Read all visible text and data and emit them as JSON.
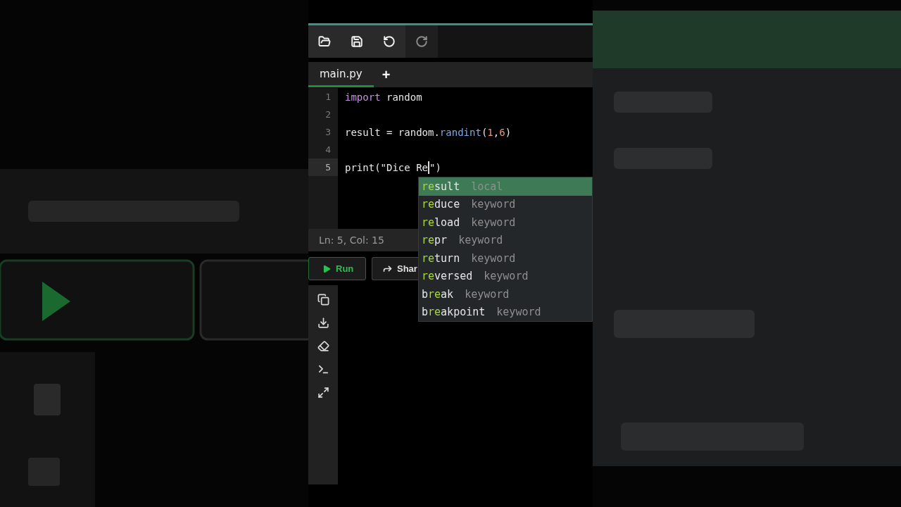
{
  "toolbar": [
    {
      "kind": "open",
      "disabled": false
    },
    {
      "kind": "save",
      "disabled": false
    },
    {
      "kind": "undo",
      "disabled": false
    },
    {
      "kind": "redo",
      "disabled": true
    }
  ],
  "tabs": [
    {
      "label": "main.py",
      "selected": true
    }
  ],
  "add_tab": "+",
  "editor": {
    "lines": [
      {
        "number": "1",
        "active": false,
        "tokens": [
          {
            "kind": "keyword",
            "text": "import"
          },
          {
            "kind": "plain",
            "text": " random"
          }
        ]
      },
      {
        "number": "2",
        "active": false
      },
      {
        "number": "3",
        "active": false,
        "tokens": [
          {
            "kind": "plain",
            "text": "result = random."
          },
          {
            "kind": "function",
            "text": "randint"
          },
          {
            "kind": "plain",
            "text": "("
          },
          {
            "kind": "number",
            "text": "1"
          },
          {
            "kind": "plain",
            "text": ","
          },
          {
            "kind": "number",
            "text": "6"
          },
          {
            "kind": "plain",
            "text": ")"
          }
        ]
      },
      {
        "number": "4",
        "active": false
      },
      {
        "number": "5",
        "active": true,
        "tokens": [
          {
            "kind": "plain",
            "text": "print(\"Dice Re"
          },
          {
            "kind": "cursor"
          },
          {
            "kind": "plain",
            "text": "\")"
          }
        ]
      }
    ]
  },
  "status_bar": "Ln: 5, Col: 15",
  "run_button": "Run",
  "share_button": "Shar",
  "autocomplete": [
    {
      "match": "re",
      "after": "sult",
      "detail": "local",
      "selected": true
    },
    {
      "match": "re",
      "after": "duce",
      "detail": "keyword",
      "selected": false
    },
    {
      "match": "re",
      "after": "load",
      "detail": "keyword",
      "selected": false
    },
    {
      "match": "re",
      "after": "pr",
      "detail": "keyword",
      "selected": false
    },
    {
      "match": "re",
      "after": "turn",
      "detail": "keyword",
      "selected": false
    },
    {
      "match": "re",
      "after": "versed",
      "detail": "keyword",
      "selected": false
    },
    {
      "before": "b",
      "match": "re",
      "after": "ak",
      "detail": "keyword",
      "selected": false
    },
    {
      "before": "b",
      "match": "re",
      "after": "akpoint",
      "detail": "keyword",
      "selected": false
    }
  ],
  "side_tools": [
    {
      "kind": "copy"
    },
    {
      "kind": "download"
    },
    {
      "kind": "eraser"
    },
    {
      "kind": "terminal"
    },
    {
      "kind": "expand"
    }
  ]
}
